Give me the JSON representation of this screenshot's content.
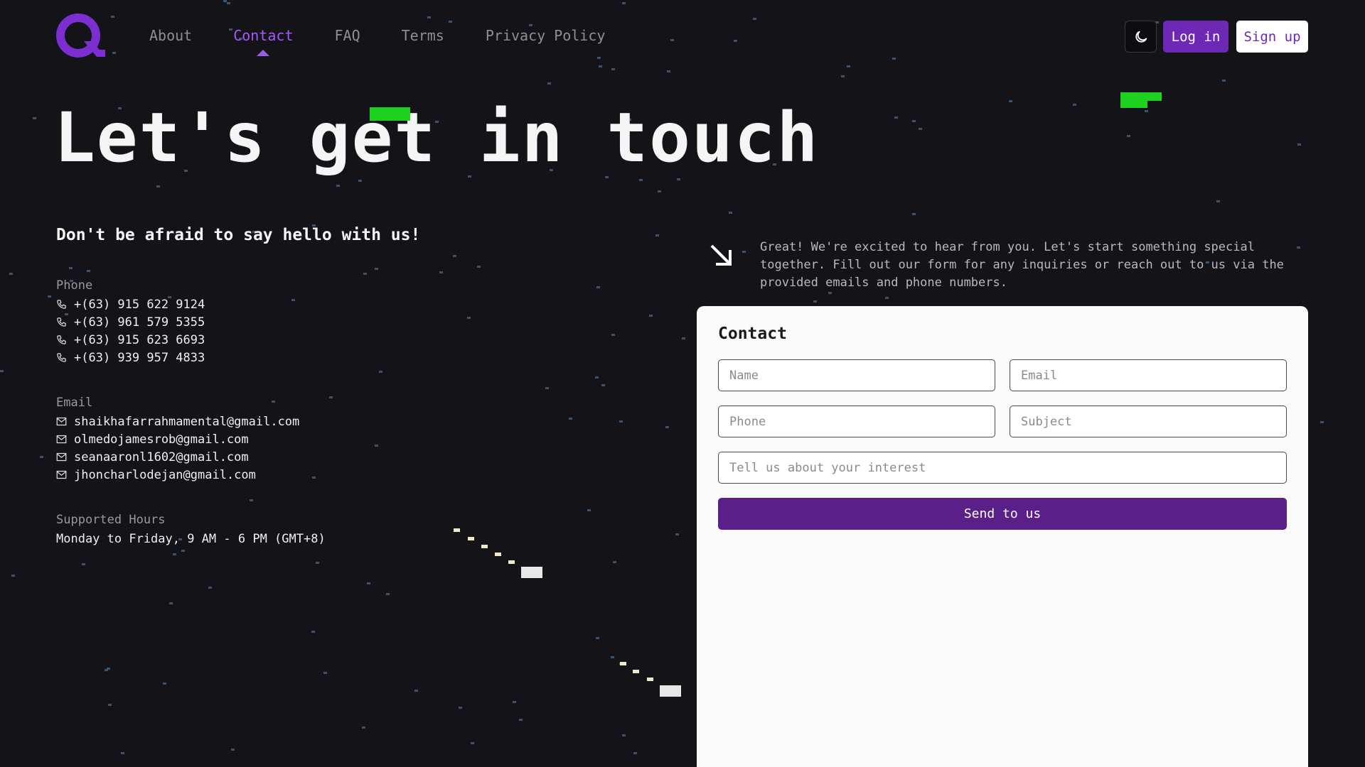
{
  "nav": {
    "items": [
      {
        "label": "About",
        "active": false
      },
      {
        "label": "Contact",
        "active": true
      },
      {
        "label": "FAQ",
        "active": false
      },
      {
        "label": "Terms",
        "active": false
      },
      {
        "label": "Privacy Policy",
        "active": false
      }
    ],
    "theme_toggle_icon": "moon-icon",
    "login_label": "Log in",
    "signup_label": "Sign up"
  },
  "hero": {
    "title": "Let's get in touch"
  },
  "contact_info": {
    "subtitle": "Don't be afraid to say hello with us!",
    "phone_label": "Phone",
    "phones": [
      "+(63) 915 622 9124",
      "+(63) 961 579 5355",
      "+(63) 915 623 6693",
      "+(63) 939 957 4833"
    ],
    "email_label": "Email",
    "emails": [
      "shaikhafarrahmamental@gmail.com",
      "olmedojamesrob@gmail.com",
      "seanaaronl1602@gmail.com",
      "jhoncharlodejan@gmail.com"
    ],
    "hours_label": "Supported Hours",
    "hours_value": "Monday to Friday, 9 AM - 6 PM (GMT+8)"
  },
  "intro": {
    "text": "Great! We're excited to hear from you. Let's start something special together. Fill out our form for any inquiries or reach out to us via the provided emails and phone numbers."
  },
  "form": {
    "title": "Contact",
    "name_placeholder": "Name",
    "email_placeholder": "Email",
    "phone_placeholder": "Phone",
    "subject_placeholder": "Subject",
    "interest_placeholder": "Tell us about your interest",
    "submit_label": "Send to us"
  },
  "colors": {
    "background": "#141317",
    "accent": "#6d28b5",
    "pixel_green": "#1ed11e"
  }
}
